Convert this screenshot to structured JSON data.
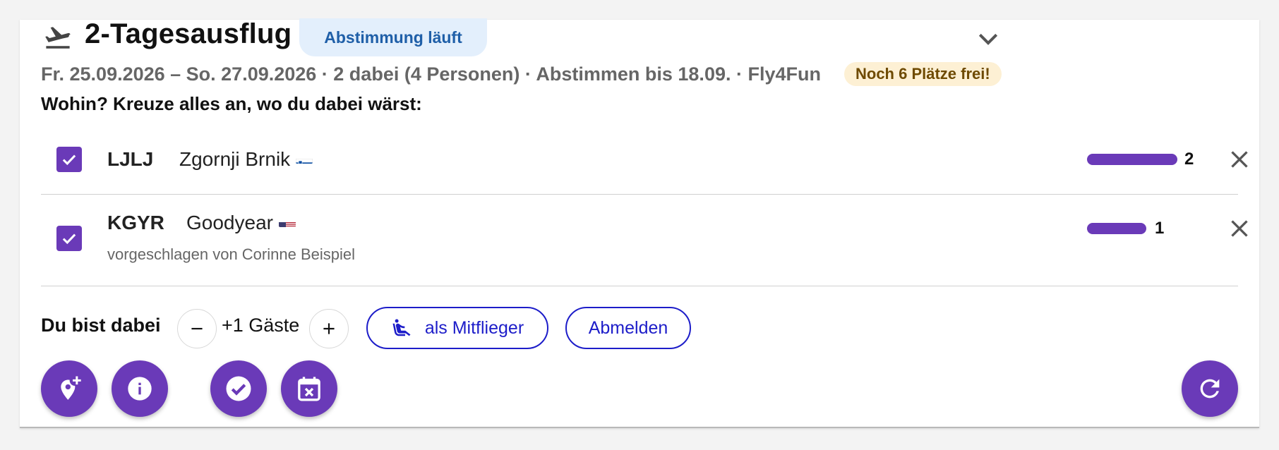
{
  "trip": {
    "title": "2-Tagesausflug",
    "status": "Abstimmung läuft",
    "meta": "Fr. 25.09.2026 – So. 27.09.2026 · 2 dabei (4 Personen) · Abstimmen bis 18.09. · Fly4Fun",
    "seats_badge": "Noch 6 Plätze frei!",
    "question": "Wohin? Kreuze alles an, wo du dabei wärst:"
  },
  "destinations": [
    {
      "code": "LJLJ",
      "name": "Zgornji Brnik",
      "flag": "slovenia-flag-icon",
      "checked": true,
      "votes": "2",
      "vote_share": 1.0,
      "suggested_by": ""
    },
    {
      "code": "KGYR",
      "name": "Goodyear",
      "flag": "usa-flag-icon",
      "checked": true,
      "votes": "1",
      "vote_share": 0.5,
      "suggested_by": "vorgeschlagen von Corinne Beispiel"
    }
  ],
  "participation": {
    "label": "Du bist dabei",
    "guests": "+1 Gäste",
    "copilot_button": "als Mitflieger",
    "leave_button": "Abmelden"
  },
  "fabs": [
    "add-location-icon",
    "info-icon",
    "check-circle-icon",
    "calendar-cancel-icon",
    "refresh-icon"
  ],
  "colors": {
    "accent": "#6a3ab8",
    "link": "#1d1dc9",
    "status_bg": "#e3effc",
    "status_text": "#1f5fa8",
    "badge_bg": "#fdf0d4",
    "badge_text": "#6e4a00"
  }
}
